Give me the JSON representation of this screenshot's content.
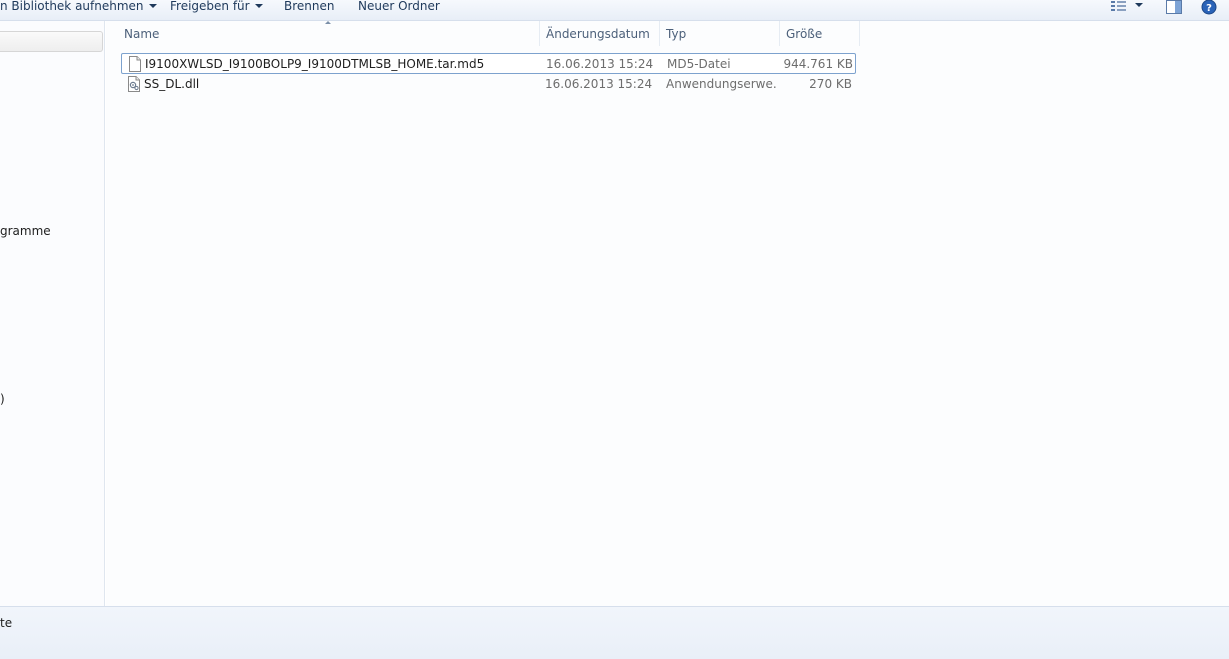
{
  "toolbar": {
    "include_library_label": "n Bibliothek aufnehmen",
    "share_label": "Freigeben für",
    "burn_label": "Brennen",
    "new_folder_label": "Neuer Ordner"
  },
  "navpane": {
    "partial_labels": [
      "gramme",
      ")"
    ]
  },
  "columns": {
    "name": "Name",
    "date": "Änderungsdatum",
    "type": "Typ",
    "size": "Größe"
  },
  "files": [
    {
      "name": "I9100XWLSD_I9100BOLP9_I9100DTMLSB_HOME.tar.md5",
      "date": "16.06.2013 15:24",
      "type": "MD5-Datei",
      "size": "944.761 KB",
      "icon": "blank-file-icon"
    },
    {
      "name": "SS_DL.dll",
      "date": "16.06.2013 15:24",
      "type": "Anwendungserwe...",
      "size": "270 KB",
      "icon": "dll-file-icon"
    }
  ],
  "statusbar": {
    "text": "te"
  },
  "colors": {
    "toolbar_text": "#1e395b",
    "header_text": "#4c607a",
    "focus_border": "#7da2ce"
  }
}
